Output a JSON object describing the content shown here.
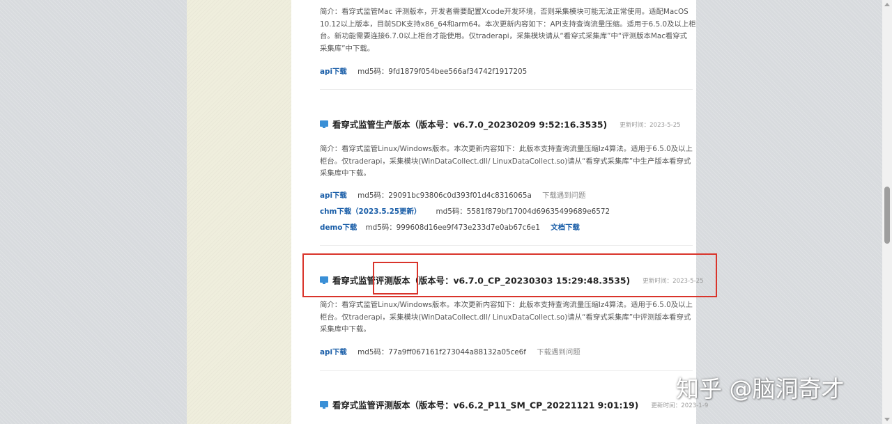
{
  "colors": {
    "link": "#1a5ea8",
    "highlight": "#d9342b",
    "icon": "#3a8fd6"
  },
  "section1": {
    "desc_lines": [
      "简介：看穿式监管Mac 评测版本，开发者需要配置Xcode开发环境，否则采集模块可能无法正常使用。适配MacOS",
      "10.12以上版本，目前SDK支持x86_64和arm64。本次更新内容如下：API支持查询流量压缩。适用于6.5.0及以上柜",
      "台。新功能需要连接6.7.0以上柜台才能使用。仅traderapi，采集模块请从“看穿式采集库”中“评测版本Mac看穿式",
      "采集库”中下载。"
    ],
    "api_label": "api下载",
    "md5": "md5码：9fd1879f054bee566af34742f1917205"
  },
  "section2": {
    "icon": "monitor-icon",
    "title": "看穿式监管生产版本（版本号：v6.7.0_20230209 9:52:16.3535)",
    "date": "更新时间：2023-5-25",
    "desc_lines": [
      "简介：看穿式监管Linux/Windows版本。本次更新内容如下：此版本支持查询流量压缩lz4算法。适用于6.5.0及以上",
      "柜台。仅traderapi，采集模块(WinDataCollect.dll/ LinuxDataCollect.so)请从“看穿式采集库”中生产版本看穿式",
      "采集库中下载。"
    ],
    "api_label": "api下载",
    "api_md5": "md5码：29091bc93806c0d393f01d4c8316065a",
    "api_issue": "下载遇到问题",
    "chm_label": "chm下载（2023.5.25更新）",
    "chm_md5": "md5码：5581f879bf17004d69635499689e6572",
    "demo_label": "demo下载",
    "demo_md5": "md5码：999608d16ee9f473e233d7e0ab67c6e1",
    "doc_label": "文档下载"
  },
  "section3": {
    "icon": "monitor-icon",
    "title": "看穿式监管评测版本（版本号：v6.7.0_CP_20230303 15:29:48.3535)",
    "date": "更新时间：2023-5-25",
    "desc_lines": [
      "简介：看穿式监管Linux/Windows版本。本次更新内容如下：此版本支持查询流量压缩lz4算法。适用于6.5.0及以上",
      "柜台。仅traderapi，采集模块(WinDataCollect.dll/ LinuxDataCollect.so)请从“看穿式采集库”中评测版本看穿式",
      "采集库中下载。"
    ],
    "api_label": "api下载",
    "api_md5": "md5码：77a9ff067161f273044a88132a05ce6f",
    "api_issue": "下载遇到问题"
  },
  "section4": {
    "icon": "monitor-icon",
    "title": "看穿式监管评测版本（版本号：v6.6.2_P11_SM_CP_20221121 9:01:19)",
    "date": "更新时间：2023-1-9"
  },
  "watermark": "知乎 @脑洞奇才"
}
